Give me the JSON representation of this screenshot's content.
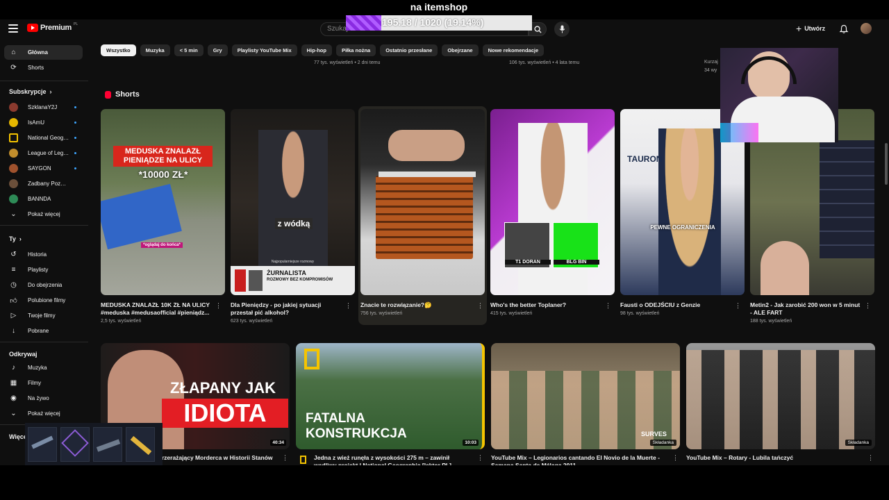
{
  "header": {
    "logo_text": "Premium",
    "logo_region": "PL",
    "search_placeholder": "Szukaj",
    "create_label": "Utwórz"
  },
  "overlay": {
    "itemshop_label": "na itemshop",
    "progress_text": "195.18 / 1020 (19.14%)",
    "progress_fraction": 0.1914
  },
  "sidebar": {
    "main": [
      {
        "label": "Główna",
        "icon": "home-icon"
      },
      {
        "label": "Shorts",
        "icon": "shorts-icon"
      }
    ],
    "subscriptions_title": "Subskrypcje",
    "subscriptions": [
      {
        "label": "SzklanaY2J",
        "color": "#8b3a2e"
      },
      {
        "label": "IsAmU",
        "color": "#e6b800"
      },
      {
        "label": "National Geogra...",
        "color": "#111111"
      },
      {
        "label": "League of Legen...",
        "color": "#c28e2c"
      },
      {
        "label": "SAYGON",
        "color": "#a0522d"
      },
      {
        "label": "Zadbany Pozwany",
        "color": "#6b4f3a"
      },
      {
        "label": "BANNDA",
        "color": "#2e8b57"
      }
    ],
    "show_more": "Pokaż więcej",
    "you_title": "Ty",
    "you": [
      {
        "label": "Historia",
        "icon": "history-icon"
      },
      {
        "label": "Playlisty",
        "icon": "playlist-icon"
      },
      {
        "label": "Do obejrzenia",
        "icon": "clock-icon"
      },
      {
        "label": "Polubione filmy",
        "icon": "thumb-up-icon"
      },
      {
        "label": "Twoje filmy",
        "icon": "video-icon"
      },
      {
        "label": "Pobrane",
        "icon": "download-icon"
      }
    ],
    "explore_title": "Odkrywaj",
    "explore": [
      {
        "label": "Muzyka",
        "icon": "music-icon"
      },
      {
        "label": "Filmy",
        "icon": "film-icon"
      },
      {
        "label": "Na żywo",
        "icon": "live-icon"
      }
    ],
    "show_more_2": "Pokaż więcej",
    "more_title": "Więcej"
  },
  "chips": [
    "Wszystko",
    "Muzyka",
    "< 5 min",
    "Gry",
    "Playlisty YouTube Mix",
    "Hip-hop",
    "Piłka nożna",
    "Ostatnio przesłane",
    "Obejrzane",
    "Nowe rekomendacje"
  ],
  "top_meta": [
    "77 tys. wyświetleń • 2 dni temu",
    "106 tys. wyświetleń • 4 lata temu",
    "Kurzaj",
    "34 wy"
  ],
  "shorts_title": "Shorts",
  "shorts": [
    {
      "title": "MEDUSKA ZNALAZŁ 10K ZŁ NA ULICY #meduska #medusaofficial #pieniądz...",
      "views": "2,5 tys. wyświetleń",
      "overlay": "MEDUSKA ZNALAZŁ PIENIĄDZE NA ULICY",
      "overlay2": "*10000 ZŁ*",
      "caption": "*oglądaj do końca*"
    },
    {
      "title": "Dla Pieniędzy - po jakiej sytuacji przestał pić alkohol?",
      "views": "623 tys. wyświetleń",
      "overlay": "z wódką",
      "banner": "ŻURNALISTA",
      "banner_sub": "ROZMOWY BEZ KOMPROMISÓW",
      "banner_tag": "Najpopularniejsze rozmowy"
    },
    {
      "title": "Znacie te rozwiązanie?🤔",
      "views": "756 tys. wyświetleń"
    },
    {
      "title": "Who's the better Toplaner?",
      "views": "415 tys. wyświetleń",
      "card1": "T1 DORAN",
      "card2": "BLG BIN"
    },
    {
      "title": "Fausti o ODEJŚCIU z Genzie",
      "views": "98 tys. wyświetleń",
      "overlay": "PEWNE OGRANICZENIA",
      "brand": "TAURON"
    },
    {
      "title": "Metin2 - Jak zarobić 200 won w 5 minut - ALE FART",
      "views": "188 tys. wyświetleń"
    }
  ],
  "videos": [
    {
      "title": "Złapany Najbardziej Przerażający Morderca w Historii Stanów Zjednoczonych?",
      "duration": "40:34",
      "overlay1": "ZŁAPANY JAK",
      "overlay2": "IDIOTA"
    },
    {
      "title": "Jedna z wież runęła z wysokości 275 m – zawinił wadliwy projekt | National Geographic [lektor PL]",
      "duration": "10:03",
      "overlay1": "FATALNA",
      "overlay2": "KONSTRUKCJA"
    },
    {
      "title": "YouTube Mix – Legionarios cantando El Novio de la Muerte - Semana Santa de Málaga 2011",
      "mix": "Składanka",
      "overlay1": "SURVES"
    },
    {
      "title": "YouTube Mix – Rotary - Lubila tańczyć",
      "mix": "Składanka"
    }
  ],
  "colors": {
    "accent": "#ff0000",
    "background": "#0f0f0f",
    "chip": "#272727",
    "link_dot": "#3ea6ff",
    "progress": "#8a2be2"
  }
}
